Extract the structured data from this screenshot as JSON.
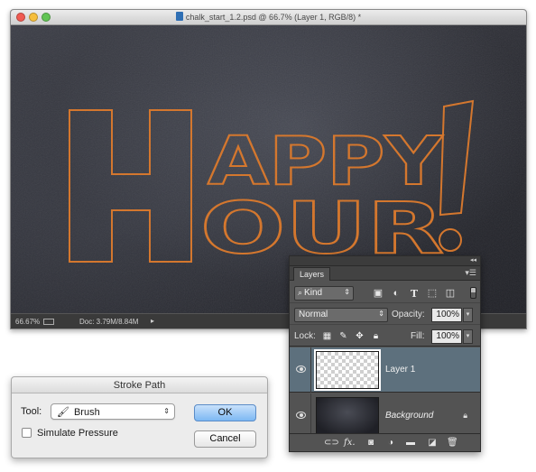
{
  "document": {
    "title": "chalk_start_1.2.psd @ 66.7% (Layer 1, RGB/8) *",
    "artwork_line1": "HAPPY",
    "artwork_line2": "HOUR!",
    "status": {
      "zoom": "66.67%",
      "doc_size": "Doc: 3.79M/8.84M",
      "arrow": "▸"
    },
    "colors": {
      "outline": "#d4772e",
      "background": "#2b2c33"
    }
  },
  "layers_panel": {
    "tab_label": "Layers",
    "collapse_icon": "◂◂",
    "menu_icon": "▾☰",
    "filter": {
      "kind_label": "Kind",
      "icons": [
        "image-filter-icon",
        "adjustment-filter-icon",
        "type-filter-icon",
        "shape-filter-icon",
        "smart-object-filter-icon"
      ]
    },
    "blend_mode": "Normal",
    "opacity_label": "Opacity:",
    "opacity_value": "100%",
    "lock_label": "Lock:",
    "fill_label": "Fill:",
    "fill_value": "100%",
    "layers": [
      {
        "name": "Layer 1",
        "selected": true
      },
      {
        "name": "Background",
        "selected": false,
        "locked": true
      }
    ],
    "footer_icons": [
      "link-icon",
      "fx-icon",
      "mask-icon",
      "adjustment-icon",
      "folder-icon",
      "new-layer-icon",
      "trash-icon"
    ],
    "fx_label": "fx."
  },
  "stroke_dialog": {
    "title": "Stroke Path",
    "tool_label": "Tool:",
    "tool_value": "Brush",
    "simulate_pressure_label": "Simulate Pressure",
    "simulate_pressure_checked": false,
    "ok_label": "OK",
    "cancel_label": "Cancel"
  }
}
